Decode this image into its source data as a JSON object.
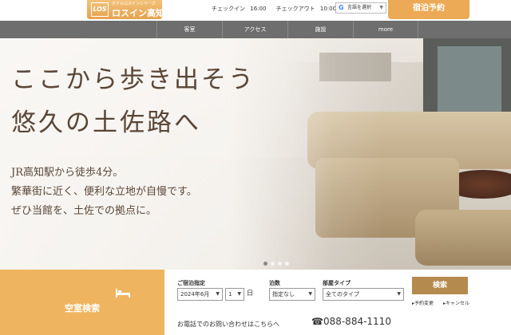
{
  "header": {
    "logo_mark": "LOS",
    "logo_sub": "ホテルロスインシリーズ",
    "logo_name": "ロスイン高知",
    "checkin_label": "チェックイン",
    "checkin_time": "16:00",
    "checkout_label": "チェックアウト",
    "checkout_time": "10:00",
    "language_select": "言語を選択",
    "book_button": "宿泊予約"
  },
  "nav": {
    "items": [
      "客室",
      "アクセス",
      "施設",
      "more"
    ]
  },
  "hero": {
    "line1": "ここから歩き出そう",
    "line2": "悠久の土佐路へ",
    "sub1": "JR高知駅から徒歩4分。",
    "sub2": "繁華街に近く、便利な立地が自慢です。",
    "sub3": "ぜひ当館を、土佐での拠点に。"
  },
  "carousel": {
    "slides": 4,
    "active": 1
  },
  "search": {
    "title": "空室検索",
    "date_label": "ご宿泊指定",
    "month_value": "2024年6月",
    "day_value": "1",
    "day_unit": "日",
    "nights_label": "泊数",
    "nights_value": "指定なし",
    "room_label": "部屋タイプ",
    "room_value": "全てのタイプ",
    "search_button": "検索",
    "change_link": "予約変更",
    "cancel_link": "キャンセル",
    "contact_text": "お電話でのお問い合わせはこちらへ",
    "phone": "☎088-884-1110"
  },
  "colors": {
    "accent": "#efb45f",
    "nav": "#6e6e6e",
    "button": "#b58a4f"
  }
}
